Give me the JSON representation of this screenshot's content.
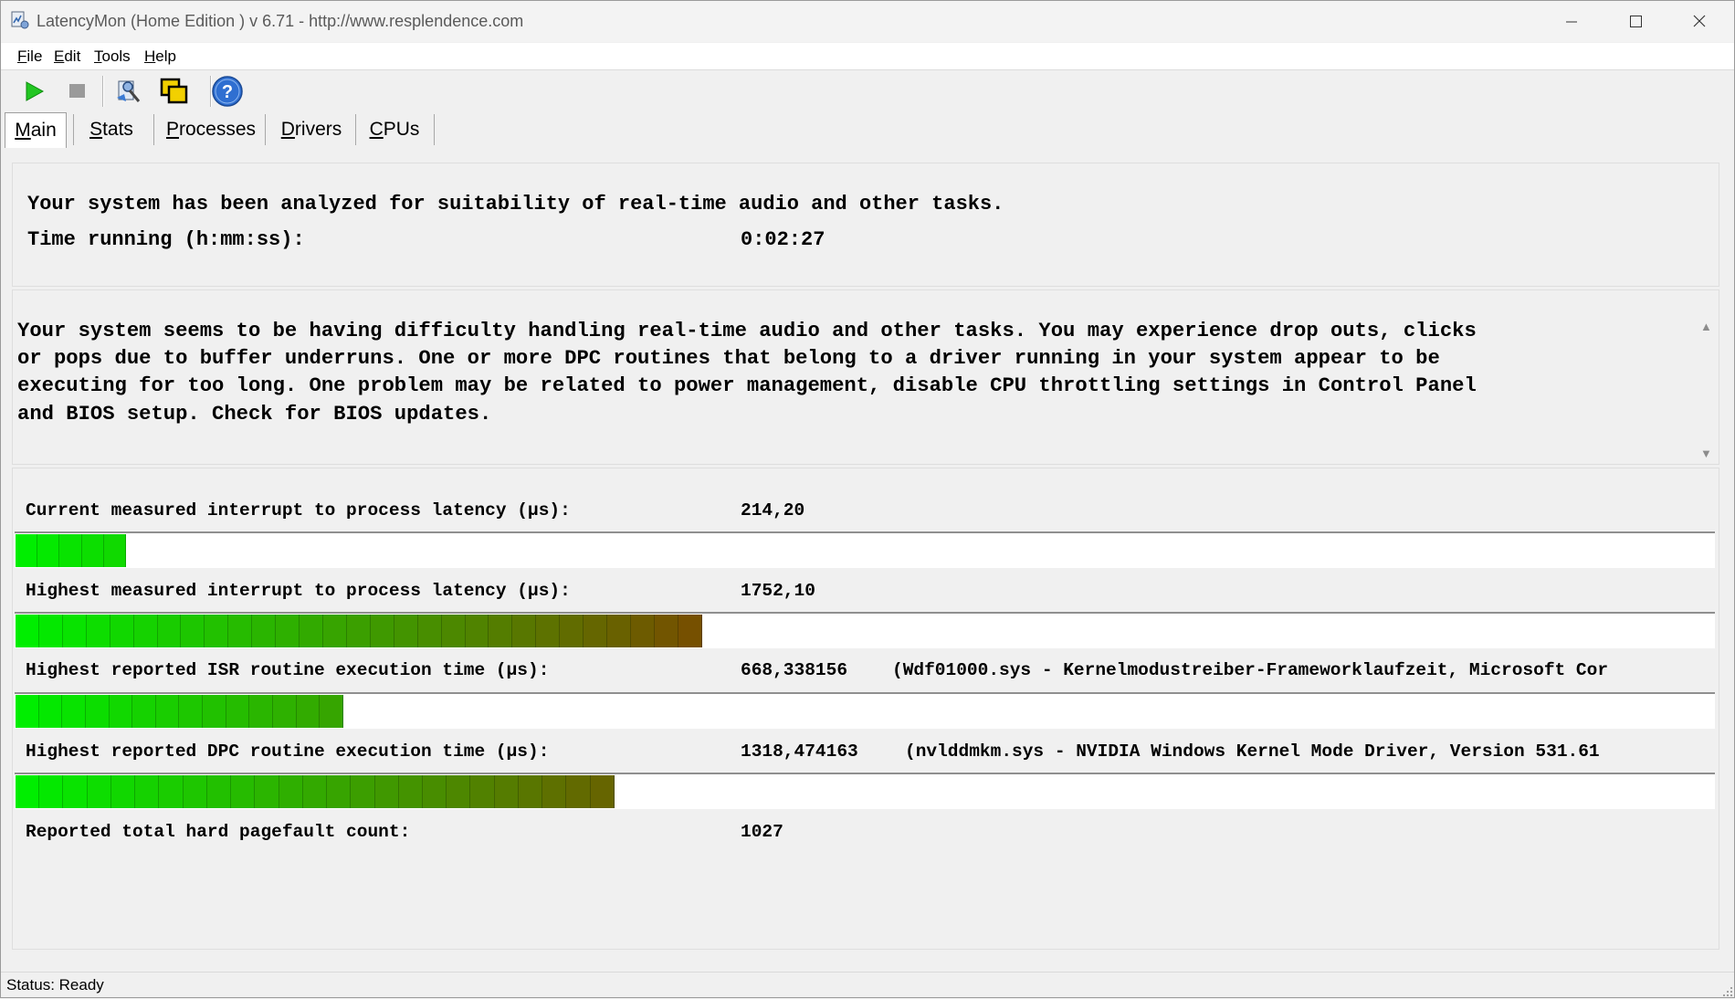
{
  "window": {
    "title": "LatencyMon  (Home Edition )  v 6.71 - http://www.resplendence.com",
    "icon": "latencymon-app-icon",
    "controls": [
      "minimize-icon",
      "maximize-icon",
      "close-icon"
    ]
  },
  "menu": {
    "items": [
      "File",
      "Edit",
      "Tools",
      "Help"
    ]
  },
  "toolbar": {
    "buttons": [
      "play-icon",
      "stop-icon",
      "analyze-drivers-icon",
      "copy-windows-icon",
      "help-icon"
    ],
    "colors": {
      "play": "#1fc51f",
      "stop": "#9a9a9a",
      "help": "#2f6fd1"
    }
  },
  "tabs": {
    "items": [
      "Main",
      "Stats",
      "Processes",
      "Drivers",
      "CPUs"
    ],
    "active": "Main"
  },
  "summary": {
    "analyzed_text": "Your system has been analyzed for suitability of real-time audio and other tasks.",
    "time_label": "Time running (h:mm:ss):",
    "time_value": "0:02:27"
  },
  "analysis": {
    "text": "Your system seems to be having difficulty handling real-time audio and other tasks. You may experience drop outs, clicks\nor pops due to buffer underruns. One or more DPC routines that belong to a driver running in your system appear to be\nexecuting for too long. One problem may be related to power management, disable CPU throttling settings in Control Panel\nand BIOS setup. Check for BIOS updates."
  },
  "metrics": [
    {
      "label": "Current measured interrupt to process latency (µs):",
      "value": "214,20",
      "detail": "",
      "bar_fraction": 0.065
    },
    {
      "label": "Highest measured interrupt to process latency (µs):",
      "value": "1752,10",
      "detail": "",
      "bar_fraction": 0.405
    },
    {
      "label": "Highest reported ISR routine execution time (µs):",
      "value": "668,338156",
      "detail": "(Wdf01000.sys - Kernelmodustreiber-Frameworklaufzeit, Microsoft Cor",
      "bar_fraction": 0.193
    },
    {
      "label": "Highest reported DPC routine execution time (µs):",
      "value": "1318,474163",
      "detail": "(nvlddmkm.sys - NVIDIA Windows Kernel Mode Driver, Version 531.61",
      "bar_fraction": 0.353
    },
    {
      "label": "Reported total hard pagefault count:",
      "value": "1027",
      "detail": ""
    }
  ],
  "status": {
    "text": "Status: Ready"
  },
  "colors": {
    "bar_green": "#00ee00",
    "bar_brown": "#7a4a00",
    "tab_active_bg": "#ffffff"
  }
}
